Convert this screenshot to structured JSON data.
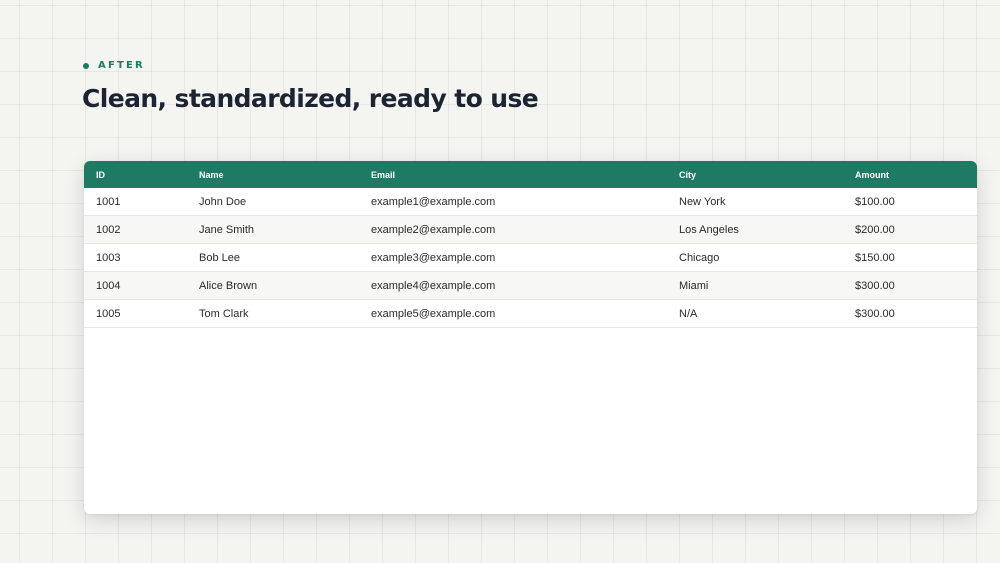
{
  "theme": {
    "accent": "#1f7a63",
    "heading_color": "#1a2433",
    "grid_background": "#f4f4f1",
    "header_text": "#ffffff",
    "row_alt": "#f7f7f6"
  },
  "eyebrow": {
    "label": "AFTER",
    "icon": "dot-icon"
  },
  "headline": "Clean, standardized, ready to use",
  "table": {
    "columns": [
      "ID",
      "Name",
      "Email",
      "City",
      "Amount"
    ],
    "rows": [
      [
        "1001",
        "John Doe",
        "example1@example.com",
        "New York",
        "$100.00"
      ],
      [
        "1002",
        "Jane Smith",
        "example2@example.com",
        "Los Angeles",
        "$200.00"
      ],
      [
        "1003",
        "Bob Lee",
        "example3@example.com",
        "Chicago",
        "$150.00"
      ],
      [
        "1004",
        "Alice Brown",
        "example4@example.com",
        "Miami",
        "$300.00"
      ],
      [
        "1005",
        "Tom Clark",
        "example5@example.com",
        "N/A",
        "$300.00"
      ]
    ]
  }
}
